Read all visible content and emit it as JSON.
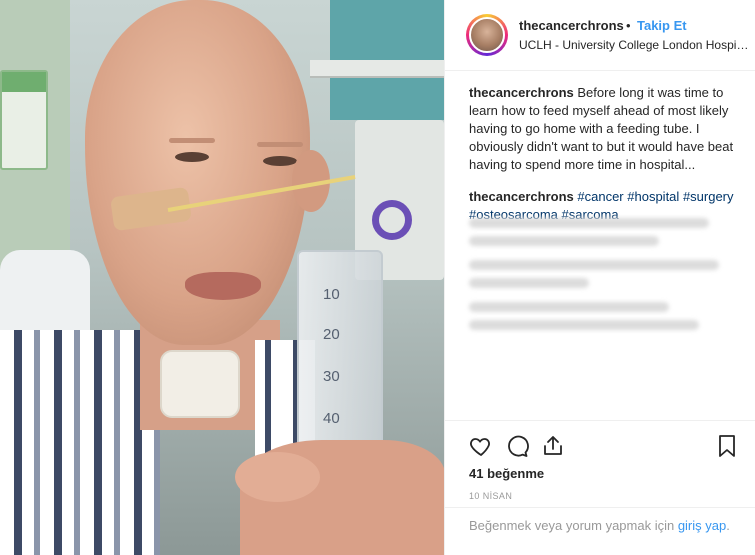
{
  "post": {
    "username": "thecancerchrons",
    "separator": "•",
    "follow_label": "Takip Et",
    "location": "UCLH - University College London Hospita..."
  },
  "caption": {
    "username": "thecancerchrons",
    "text": "Before long it was time to learn how to feed myself ahead of most likely having to go home with a feeding tube. I obviously didn't want to but it would have beat having to spend more time in hospital..."
  },
  "tags_comment": {
    "username": "thecancerchrons",
    "tags": [
      "#cancer",
      "#hospital",
      "#surgery",
      "#osteosarcoma",
      "#sarcoma"
    ]
  },
  "photo": {
    "syringe_marks": [
      "10",
      "20",
      "30",
      "40"
    ]
  },
  "actions": {
    "icons": [
      "heart-icon",
      "comment-icon",
      "share-icon",
      "bookmark-icon"
    ],
    "likes": "41 beğenme",
    "date": "10 NİSAN"
  },
  "login": {
    "prompt": "Beğenmek veya yorum yapmak için ",
    "link": "giriş yap",
    "suffix": "."
  },
  "colors": {
    "link_blue": "#3897f0",
    "hashtag": "#003569",
    "text": "#262626",
    "muted": "#999999"
  }
}
